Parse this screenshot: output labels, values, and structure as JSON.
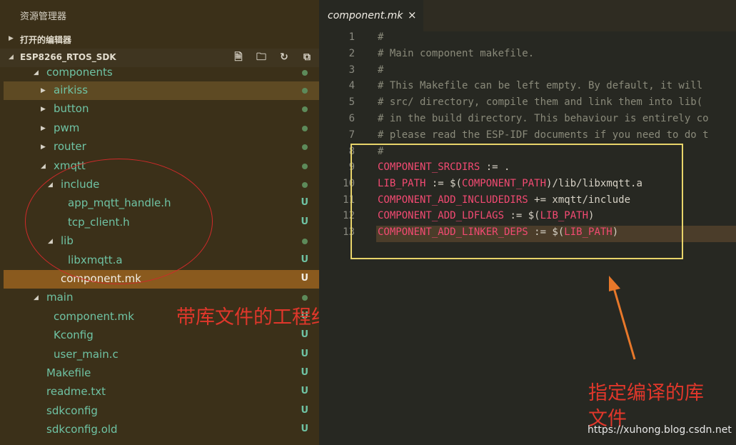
{
  "explorer": {
    "title": "资源管理器",
    "open_editors_label": "打开的编辑器",
    "project_label": "ESP8266_RTOS_SDK",
    "toolbar_icons": [
      "new-file-icon",
      "new-folder-icon",
      "refresh-icon",
      "collapse-all-icon"
    ]
  },
  "tree": [
    {
      "label": "components",
      "status": "dot"
    },
    {
      "label": "airkiss",
      "status": "dot"
    },
    {
      "label": "button",
      "status": "dot"
    },
    {
      "label": "pwm",
      "status": "dot"
    },
    {
      "label": "router",
      "status": "dot"
    },
    {
      "label": "xmqtt",
      "status": "dot"
    },
    {
      "label": "include",
      "status": "dot"
    },
    {
      "label": "app_mqtt_handle.h",
      "status": "U"
    },
    {
      "label": "tcp_client.h",
      "status": "U"
    },
    {
      "label": "lib",
      "status": "dot"
    },
    {
      "label": "libxmqtt.a",
      "status": "U"
    },
    {
      "label": "component.mk",
      "status": "U"
    },
    {
      "label": "main",
      "status": "dot"
    },
    {
      "label": "component.mk",
      "status": "U"
    },
    {
      "label": "Kconfig",
      "status": "U"
    },
    {
      "label": "user_main.c",
      "status": "U"
    },
    {
      "label": "Makefile",
      "status": "U"
    },
    {
      "label": "readme.txt",
      "status": "U"
    },
    {
      "label": "sdkconfig",
      "status": "U"
    },
    {
      "label": "sdkconfig.old",
      "status": "U"
    }
  ],
  "tab": {
    "name": "component.mk",
    "close": "×"
  },
  "line_numbers": [
    "1",
    "2",
    "3",
    "4",
    "5",
    "6",
    "7",
    "8",
    "9",
    "10",
    "11",
    "12",
    "13"
  ],
  "code": {
    "l1": "#",
    "l2": "# Main component makefile.",
    "l3": "#",
    "l4": "# This Makefile can be left empty. By default, it will",
    "l5": "# src/ directory, compile them and link them into lib(",
    "l6": "# in the build directory. This behaviour is entirely co",
    "l7": "# please read the ESP-IDF documents if you need to do t",
    "l8": "#",
    "l9_var": "COMPONENT_SRCDIRS",
    "l9_rest": " := .",
    "l10_var": "LIB_PATH",
    "l10_a": " := $(",
    "l10_var2": "COMPONENT_PATH",
    "l10_b": ")/lib/libxmqtt.a",
    "l11_var": "COMPONENT_ADD_INCLUDEDIRS",
    "l11_rest": " += xmqtt/include",
    "l12_var": "COMPONENT_ADD_LDFLAGS",
    "l12_a": " := $(",
    "l12_var2": "LIB_PATH",
    "l12_b": ")",
    "l13_var": "COMPONENT_ADD_LINKER_DEPS",
    "l13_a": " := $(",
    "l13_var2": "LIB_PATH",
    "l13_b": ")"
  },
  "annotations": {
    "structure": "带库文件的工程结构",
    "specify_lib_1": "指定编译的库",
    "specify_lib_2": "文件"
  },
  "watermark": "https://xuhong.blog.csdn.net",
  "colors": {
    "annotation_red": "#e0372b",
    "highlight_box": "#e8d46a",
    "git_untracked": "#6fc3a4"
  }
}
